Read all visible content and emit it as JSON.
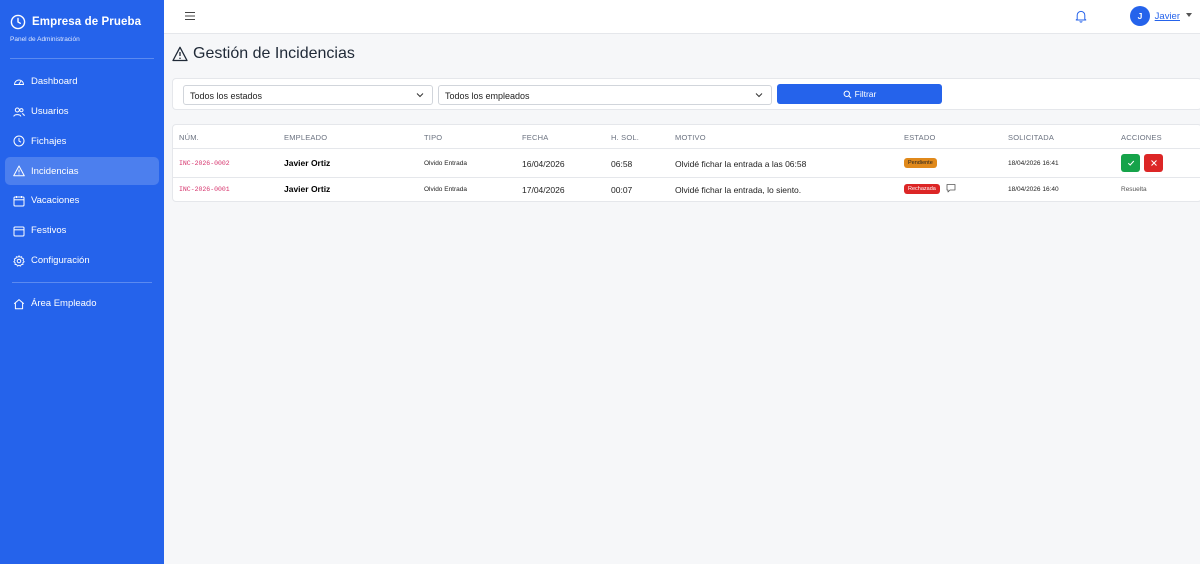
{
  "sidebar": {
    "brand_name": "Empresa de Prueba",
    "brand_sub": "Panel de Administración",
    "items": [
      {
        "label": "Dashboard",
        "icon": "gauge-icon"
      },
      {
        "label": "Usuarios",
        "icon": "users-icon"
      },
      {
        "label": "Fichajes",
        "icon": "clock-icon"
      },
      {
        "label": "Incidencias",
        "icon": "warning-icon",
        "active": true
      },
      {
        "label": "Vacaciones",
        "icon": "calendar-icon"
      },
      {
        "label": "Festivos",
        "icon": "calendar-icon"
      },
      {
        "label": "Configuración",
        "icon": "gear-icon"
      }
    ],
    "employee_area": "Área Empleado"
  },
  "topbar": {
    "user_initial": "J",
    "user_name": "Javier"
  },
  "page": {
    "title": "Gestión de Incidencias"
  },
  "filters": {
    "estado_value": "Todos los estados",
    "empleado_value": "Todos los empleados",
    "filter_label": "Filtrar"
  },
  "table": {
    "headers": {
      "num": "NÚM.",
      "empleado": "EMPLEADO",
      "tipo": "TIPO",
      "fecha": "FECHA",
      "hsol": "H. SOL.",
      "motivo": "MOTIVO",
      "estado": "ESTADO",
      "solicitada": "SOLICITADA",
      "acciones": "ACCIONES"
    },
    "rows": [
      {
        "num": "INC-2026-0002",
        "empleado": "Javier Ortiz",
        "tipo": "Olvido Entrada",
        "fecha": "16/04/2026",
        "hsol": "06:58",
        "motivo": "Olvidé fichar la entrada a las 06:58",
        "estado": "Pendiente",
        "solicitada": "18/04/2026 16:41"
      },
      {
        "num": "INC-2026-0001",
        "empleado": "Javier Ortiz",
        "tipo": "Olvido Entrada",
        "fecha": "17/04/2026",
        "hsol": "00:07",
        "motivo": "Olvidé fichar la entrada, lo siento.",
        "estado": "Rechazada",
        "solicitada": "18/04/2026 16:40",
        "accion": "Resuelta"
      }
    ]
  },
  "colors": {
    "primary": "#2563eb",
    "pending": "#e0891b",
    "rejected": "#dc2626",
    "approve": "#16a34a",
    "code": "#d6336c"
  }
}
